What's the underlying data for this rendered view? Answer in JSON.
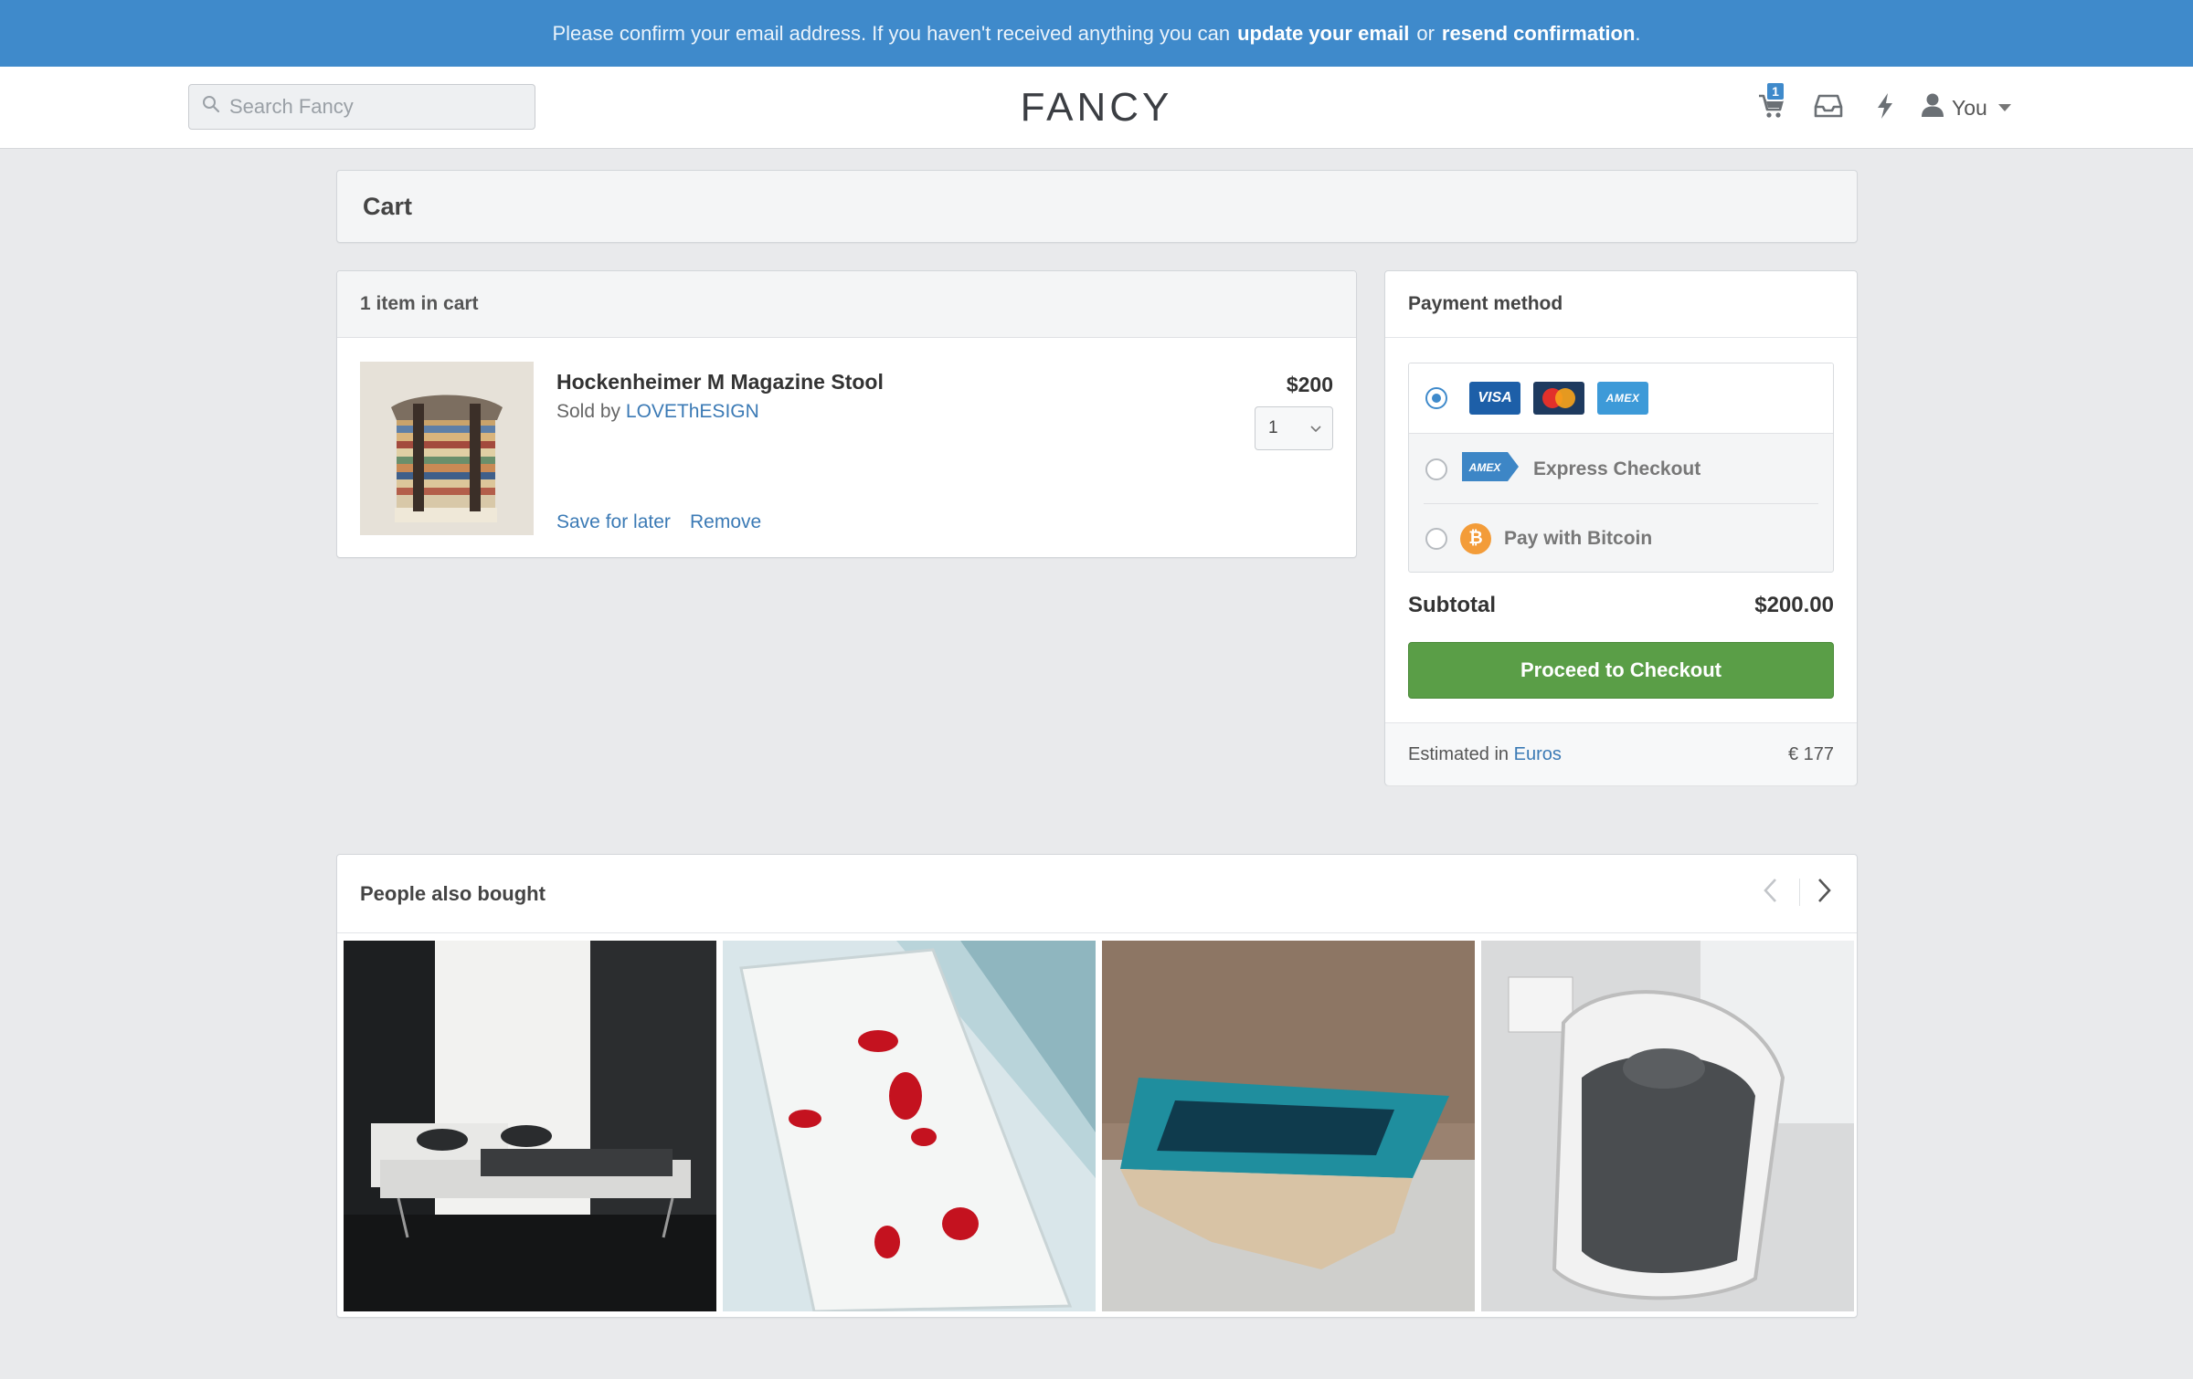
{
  "banner": {
    "text_before": "Please confirm your email address. If you haven't received anything you can",
    "update_link": "update your email",
    "or_text": "or",
    "resend_link": "resend confirmation",
    "period": "."
  },
  "header": {
    "search_placeholder": "Search Fancy",
    "logo": "FANCY",
    "cart_badge": "1",
    "user_label": "You"
  },
  "cart": {
    "title": "Cart",
    "count_label": "1 item in cart",
    "item": {
      "name": "Hockenheimer M Magazine Stool",
      "sold_by_label": "Sold by",
      "seller": "LOVEThESIGN",
      "price": "$200",
      "quantity": "1",
      "save_for_later": "Save for later",
      "remove": "Remove"
    }
  },
  "payment": {
    "title": "Payment method",
    "card_labels": {
      "visa": "VISA",
      "amex": "AMEX"
    },
    "options": [
      {
        "label": "",
        "selected": true
      },
      {
        "label": "Express Checkout",
        "selected": false
      },
      {
        "label": "Pay with Bitcoin",
        "selected": false
      }
    ],
    "bitcoin_symbol": "₿",
    "subtotal_label": "Subtotal",
    "subtotal_value": "$200.00",
    "checkout_button": "Proceed to Checkout",
    "estimated_label": "Estimated in",
    "currency_link": "Euros",
    "estimated_value": "€ 177"
  },
  "also_bought": {
    "title": "People also bought",
    "items": [
      {
        "icon": "sofa-bed-photo"
      },
      {
        "icon": "bath-mat-photo"
      },
      {
        "icon": "abyss-table-photo"
      },
      {
        "icon": "round-bed-photo"
      }
    ]
  },
  "colors": {
    "banner": "#3f8acb",
    "link": "#3b7ab5",
    "checkout": "#5a9e47",
    "background": "#e9eaec"
  }
}
